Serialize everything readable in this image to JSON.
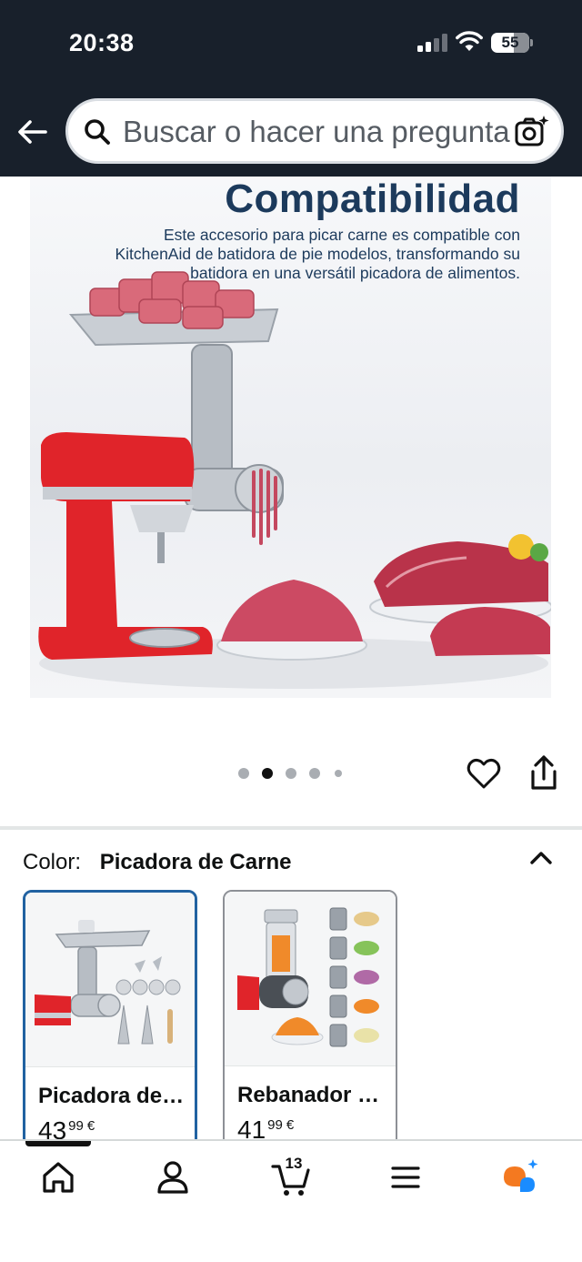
{
  "status_bar": {
    "time": "20:38",
    "battery": "55"
  },
  "search": {
    "placeholder": "Buscar o hacer una pregunta"
  },
  "hero": {
    "title": "Compatibilidad",
    "description": "Este accesorio para picar carne es compatible con KitchenAid de batidora de pie modelos, transformando su batidora en una versátil picadora de alimentos.",
    "carousel": {
      "total": 5,
      "active_index": 1
    }
  },
  "variation": {
    "label": "Color:",
    "selected_value": "Picadora de Carne",
    "options": [
      {
        "name": "Picadora de Carne",
        "price_whole": "43",
        "price_fraction": "99",
        "currency": "€",
        "selected": true
      },
      {
        "name": "Rebanador de Verduras",
        "price_whole": "41",
        "price_fraction": "99",
        "currency": "€",
        "selected": false
      }
    ]
  },
  "tabbar": {
    "cart_count": "13",
    "active_tab": "home"
  },
  "colors": {
    "header_bg": "#18202b",
    "selected_border": "#2162a1",
    "mixer_red": "#e0242a",
    "title_navy": "#1c3a5c",
    "assistant_orange": "#f47920",
    "assistant_blue": "#1a8cff"
  }
}
